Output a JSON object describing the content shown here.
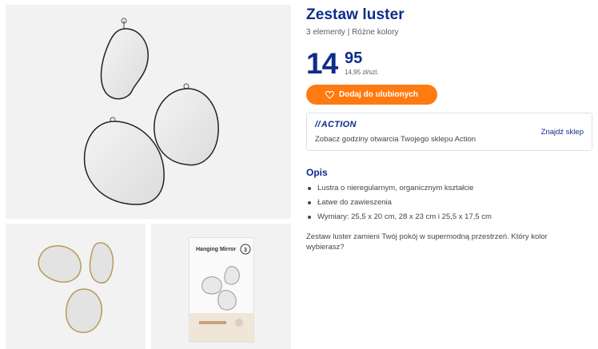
{
  "product": {
    "title": "Zestaw luster",
    "subtitle": "3 elementy | Różne kolory"
  },
  "price": {
    "integer": "14",
    "decimal": "95",
    "unit_price": "14,95 zł/szt."
  },
  "favorite_button": {
    "label": "Dodaj do ulubionych",
    "icon": "heart-icon"
  },
  "store": {
    "logo_text": "ACTION",
    "logo_prefix": "//",
    "hours_text": "Zobacz godziny otwarcia Twojego sklepu Action",
    "find_link": "Znajdź sklep"
  },
  "description": {
    "heading": "Opis",
    "bullets": [
      "Lustra o nieregularnym, organicznym kształcie",
      "Łatwe do zawieszenia",
      "Wymiary: 25,5 x 20 cm, 28 x 23 cm i 25,5 x 17,5 cm"
    ],
    "text": "Zestaw luster zamieni Twój pokój w supermodną przestrzeń. Który kolor wybierasz?"
  },
  "gallery": {
    "package_label": "Hanging Mirror",
    "package_count": "3"
  },
  "colors": {
    "brand_blue": "#0d2d8a",
    "accent_orange": "#ff7a10",
    "image_bg": "#f2f2f2"
  }
}
